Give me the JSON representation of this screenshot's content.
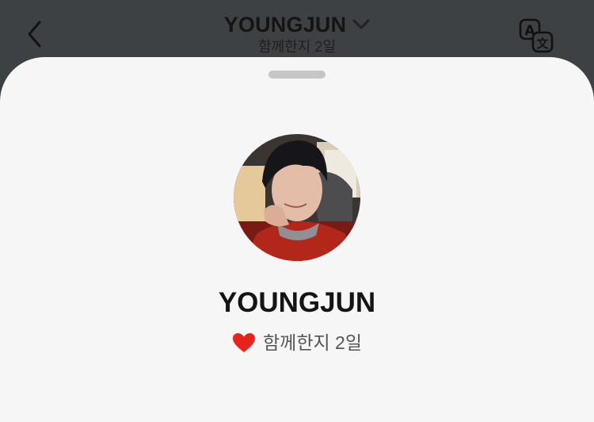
{
  "header": {
    "title": "YOUNGJUN",
    "subtitle": "함께한지 2일",
    "back_icon": "chevron-left-icon",
    "dropdown_icon": "chevron-down-icon",
    "translate_icon": "translate-icon"
  },
  "profile": {
    "name": "YOUNGJUN",
    "together_text": "함께한지 2일",
    "heart_icon": "heart-icon",
    "heart_color": "#e8231c"
  },
  "colors": {
    "header_bg": "#3e4144",
    "sheet_bg": "#f6f6f6",
    "handle": "#c6c6c6"
  }
}
